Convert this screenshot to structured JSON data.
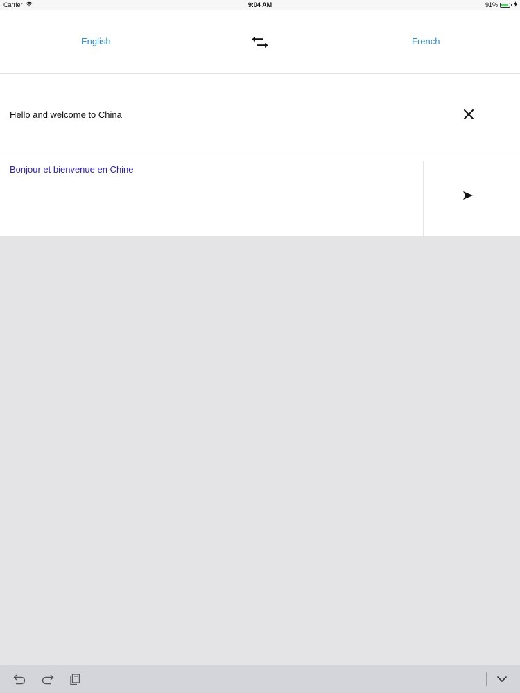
{
  "status_bar": {
    "carrier": "Carrier",
    "time": "9:04 AM",
    "battery_percent": "91%",
    "battery_level": 0.91,
    "icons": [
      "wifi-icon",
      "battery-icon",
      "charging-icon"
    ]
  },
  "languages": {
    "source": "English",
    "target": "French",
    "swap_icon": "swap-arrows-icon"
  },
  "input": {
    "text": "Hello and welcome to China",
    "clear_icon": "close-icon"
  },
  "output": {
    "text": "Bonjour et bienvenue en Chine",
    "send_icon": "send-icon"
  },
  "keyboard_toolbar": {
    "icons": [
      "undo-icon",
      "redo-icon",
      "paste-icon",
      "keyboard-dismiss-icon"
    ]
  },
  "colors": {
    "accent": "#2e8ed6",
    "translation_text": "#2a1fd1",
    "background": "#e4e4e6",
    "battery": "#4cd964"
  }
}
